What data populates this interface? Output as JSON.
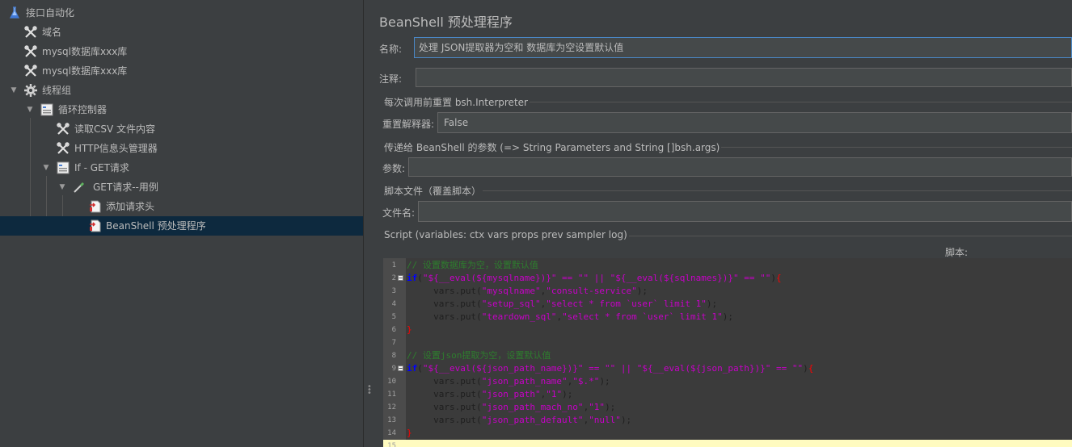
{
  "tree": {
    "items": [
      {
        "label": "接口自动化",
        "icon": "flask-icon",
        "toggle": "",
        "selected": false
      },
      {
        "label": "域名",
        "icon": "wrench-icon",
        "toggle": "",
        "selected": false
      },
      {
        "label": "mysql数据库xxx库",
        "icon": "wrench-icon",
        "toggle": "",
        "selected": false
      },
      {
        "label": "mysql数据库xxx库",
        "icon": "wrench-icon",
        "toggle": "",
        "selected": false
      },
      {
        "label": "线程组",
        "icon": "gear-icon",
        "toggle": "▼",
        "selected": false
      },
      {
        "label": "循环控制器",
        "icon": "controller-icon",
        "toggle": "▼",
        "selected": false
      },
      {
        "label": "读取CSV 文件内容",
        "icon": "wrench-icon",
        "toggle": "",
        "selected": false
      },
      {
        "label": "HTTP信息头管理器",
        "icon": "wrench-icon",
        "toggle": "",
        "selected": false
      },
      {
        "label": "If - GET请求",
        "icon": "controller-icon",
        "toggle": "▼",
        "selected": false
      },
      {
        "label": "GET请求--用例",
        "icon": "pipette-icon",
        "toggle": "▼",
        "selected": false
      },
      {
        "label": "添加请求头",
        "icon": "preprocessor-icon",
        "toggle": "",
        "selected": false
      },
      {
        "label": "BeanShell 预处理程序",
        "icon": "preprocessor-icon",
        "toggle": "",
        "selected": true
      }
    ]
  },
  "panel": {
    "title": "BeanShell 预处理程序",
    "name_label": "名称:",
    "name_value": "处理 JSON提取器为空和 数据库为空设置默认值",
    "comment_label": "注释:",
    "comment_value": "",
    "reset_group_title": "每次调用前重置 bsh.Interpreter",
    "reset_label": "重置解释器:",
    "reset_value": "False",
    "params_group_title": "传递给 BeanShell 的参数 (=> String Parameters and String []bsh.args)",
    "params_label": "参数:",
    "params_value": "",
    "file_group_title": "脚本文件（覆盖脚本）",
    "file_label": "文件名:",
    "file_value": "",
    "script_group_title": "Script (variables: ctx vars props prev sampler log)",
    "script_label": "脚本:"
  },
  "script": {
    "lines": [
      {
        "num": "1",
        "fold": "",
        "tokens": [
          {
            "t": "// 设置数据库为空，设置默认值",
            "c": "comment"
          }
        ]
      },
      {
        "num": "2",
        "fold": "−",
        "tokens": [
          {
            "t": "if",
            "c": "keyword"
          },
          {
            "t": "(",
            "c": "default"
          },
          {
            "t": "\"${__eval(${mysqlname})}\" == \"\" || \"${__eval(${sqlnames})}\" == \"\"",
            "c": "string"
          },
          {
            "t": ")",
            "c": "default"
          },
          {
            "t": "{",
            "c": "brace"
          }
        ]
      },
      {
        "num": "3",
        "fold": "",
        "tokens": [
          {
            "t": "     vars.put(",
            "c": "default"
          },
          {
            "t": "\"mysqlname\"",
            "c": "string"
          },
          {
            "t": ",",
            "c": "default"
          },
          {
            "t": "\"consult-service\"",
            "c": "string"
          },
          {
            "t": ");",
            "c": "default"
          }
        ]
      },
      {
        "num": "4",
        "fold": "",
        "tokens": [
          {
            "t": "     vars.put(",
            "c": "default"
          },
          {
            "t": "\"setup_sql\"",
            "c": "string"
          },
          {
            "t": ",",
            "c": "default"
          },
          {
            "t": "\"select * from `user` limit 1\"",
            "c": "string"
          },
          {
            "t": ");",
            "c": "default"
          }
        ]
      },
      {
        "num": "5",
        "fold": "",
        "tokens": [
          {
            "t": "     vars.put(",
            "c": "default"
          },
          {
            "t": "\"teardown_sql\"",
            "c": "string"
          },
          {
            "t": ",",
            "c": "default"
          },
          {
            "t": "\"select * from `user` limit 1\"",
            "c": "string"
          },
          {
            "t": ");",
            "c": "default"
          }
        ]
      },
      {
        "num": "6",
        "fold": "",
        "tokens": [
          {
            "t": "}",
            "c": "brace"
          }
        ]
      },
      {
        "num": "7",
        "fold": "",
        "tokens": []
      },
      {
        "num": "8",
        "fold": "",
        "tokens": [
          {
            "t": "// 设置json提取为空，设置默认值",
            "c": "comment"
          }
        ]
      },
      {
        "num": "9",
        "fold": "−",
        "tokens": [
          {
            "t": "if",
            "c": "keyword"
          },
          {
            "t": "(",
            "c": "default"
          },
          {
            "t": "\"${__eval(${json_path_name})}\" == \"\" || \"${__eval(${json_path})}\" == \"\"",
            "c": "string"
          },
          {
            "t": ")",
            "c": "default"
          },
          {
            "t": "{",
            "c": "brace"
          }
        ]
      },
      {
        "num": "10",
        "fold": "",
        "tokens": [
          {
            "t": "     vars.put(",
            "c": "default"
          },
          {
            "t": "\"json_path_name\"",
            "c": "string"
          },
          {
            "t": ",",
            "c": "default"
          },
          {
            "t": "\"$.*\"",
            "c": "string"
          },
          {
            "t": ");",
            "c": "default"
          }
        ]
      },
      {
        "num": "11",
        "fold": "",
        "tokens": [
          {
            "t": "     vars.put(",
            "c": "default"
          },
          {
            "t": "\"json_path\"",
            "c": "string"
          },
          {
            "t": ",",
            "c": "default"
          },
          {
            "t": "\"1\"",
            "c": "string"
          },
          {
            "t": ");",
            "c": "default"
          }
        ]
      },
      {
        "num": "12",
        "fold": "",
        "tokens": [
          {
            "t": "     vars.put(",
            "c": "default"
          },
          {
            "t": "\"json_path_mach_no\"",
            "c": "string"
          },
          {
            "t": ",",
            "c": "default"
          },
          {
            "t": "\"1\"",
            "c": "string"
          },
          {
            "t": ");",
            "c": "default"
          }
        ]
      },
      {
        "num": "13",
        "fold": "",
        "tokens": [
          {
            "t": "     vars.put(",
            "c": "default"
          },
          {
            "t": "\"json_path_default\"",
            "c": "string"
          },
          {
            "t": ",",
            "c": "default"
          },
          {
            "t": "\"null\"",
            "c": "string"
          },
          {
            "t": ");",
            "c": "default"
          }
        ]
      },
      {
        "num": "14",
        "fold": "",
        "tokens": [
          {
            "t": "}",
            "c": "brace"
          }
        ]
      },
      {
        "num": "15",
        "fold": "",
        "tokens": [],
        "current": true
      }
    ]
  }
}
